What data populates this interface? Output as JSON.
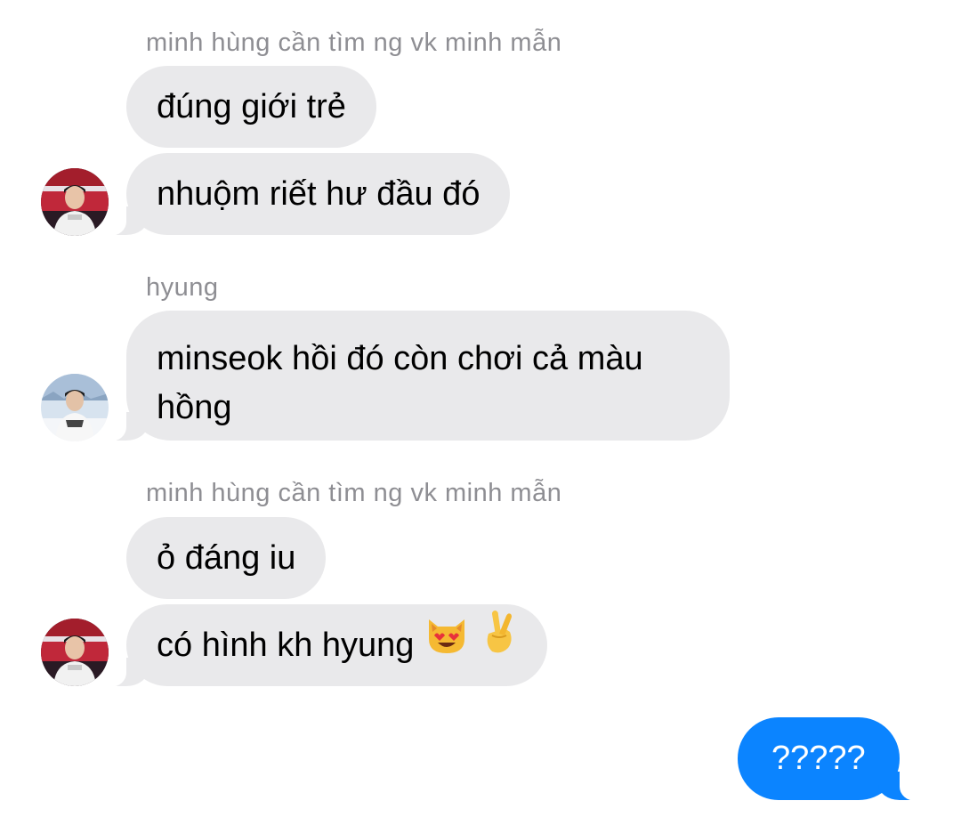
{
  "conversation": {
    "group1": {
      "sender": "minh hùng cần tìm ng vk minh mẫn",
      "messages": [
        "đúng giới trẻ",
        "nhuộm riết hư đầu đó"
      ]
    },
    "group2": {
      "sender": "hyung",
      "messages": [
        "minseok hồi đó còn chơi cả màu hồng"
      ]
    },
    "group3": {
      "sender": "minh hùng cần tìm ng vk minh mẫn",
      "messages": [
        "ỏ đáng iu",
        "có hình kh hyung"
      ]
    },
    "outgoing": {
      "messages": [
        "?????"
      ]
    }
  },
  "emojis": [
    "smiling-cat-heart-eyes-emoji",
    "crossed-fingers-emoji"
  ],
  "colors": {
    "incoming_bubble": "#e9e9eb",
    "outgoing_bubble": "#0b84ff",
    "sender_name": "#8e8e93"
  }
}
